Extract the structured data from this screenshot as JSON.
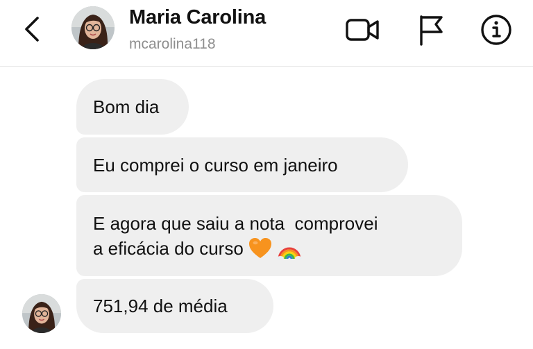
{
  "header": {
    "contact_name": "Maria Carolina",
    "username": "mcarolina118",
    "icons": {
      "back": "chevron-left-icon",
      "video": "video-camera-icon",
      "report": "flag-icon",
      "info": "info-icon"
    }
  },
  "messages": [
    {
      "text": "Bom dia"
    },
    {
      "text": "Eu comprei o curso em janeiro"
    },
    {
      "lines": [
        "E agora que saiu a nota  comprovei",
        "a eficácia do curso"
      ],
      "emojis": [
        "orange-heart",
        "rainbow"
      ]
    },
    {
      "text": "751,94 de média"
    }
  ],
  "colors": {
    "bubble": "#efefef",
    "text": "#111111",
    "username": "#8e8e8e",
    "heart": "#f7931e"
  }
}
